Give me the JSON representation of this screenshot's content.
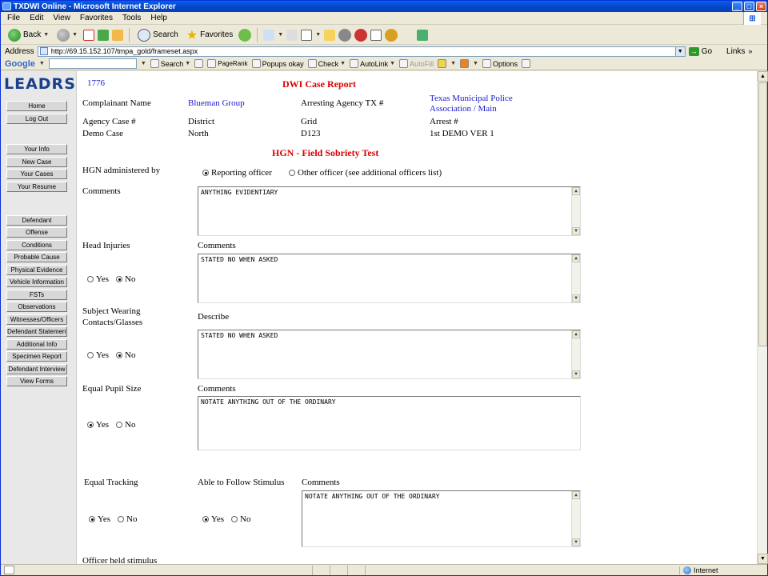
{
  "window": {
    "title": "TXDWI Online - Microsoft Internet Explorer"
  },
  "menu": [
    "File",
    "Edit",
    "View",
    "Favorites",
    "Tools",
    "Help"
  ],
  "toolbar": {
    "back": "Back",
    "search": "Search",
    "favorites": "Favorites"
  },
  "address": {
    "label": "Address",
    "url": "http://69.15.152.107/tmpa_gold/frameset.aspx",
    "go": "Go",
    "links": "Links"
  },
  "googlebar": {
    "logo": "Google",
    "search": "Search",
    "pagerank": "PageRank",
    "popups": "Popups okay",
    "check": "Check",
    "autolink": "AutoLink",
    "autofill": "AutoFill",
    "options": "Options"
  },
  "status": {
    "zone": "Internet"
  },
  "nav": {
    "logo": "LEADRS",
    "items": [
      "Home",
      "Log Out",
      "Your Info",
      "New Case",
      "Your Cases",
      "Your Resume",
      "Defendant",
      "Offense",
      "Conditions",
      "Probable Cause",
      "Physical Evidence",
      "Vehicle Information",
      "FSTs",
      "Observations",
      "Witnesses/Officers",
      "Defendant Statement",
      "Additional Info",
      "Specimen Report",
      "Defendant Interview",
      "View Forms"
    ]
  },
  "report": {
    "case_id": "1776",
    "title": "DWI Case Report",
    "complainant_label": "Complainant Name",
    "complainant_value": "Blueman Group",
    "arresting_agency_label": "Arresting Agency TX #",
    "arresting_agency_value_1": "Texas Municipal Police",
    "arresting_agency_value_2": "Association / Main",
    "agency_case_label": "Agency Case #",
    "district_label": "District",
    "grid_label": "Grid",
    "arrest_label": "Arrest #",
    "demo_case": "Demo Case",
    "north": "North",
    "grid_value": "D123",
    "arrest_value": "1st DEMO VER 1"
  },
  "hgn": {
    "section_title": "HGN - Field Sobriety Test",
    "administered_label": "HGN administered by",
    "reporting_officer": "Reporting officer",
    "other_officer": "Other officer (see additional officers list)",
    "comments_label": "Comments",
    "comments_text": "ANYTHING EVIDENTIARY",
    "head_injuries_label": "Head Injuries",
    "head_injuries_comments_label": "Comments",
    "head_injuries_text": "STATED NO WHEN ASKED",
    "yes": "Yes",
    "no": "No",
    "wearing_label_1": "Subject Wearing",
    "wearing_label_2": "Contacts/Glasses",
    "describe_label": "Describe",
    "wearing_text": "STATED NO WHEN ASKED",
    "pupil_label": "Equal Pupil Size",
    "pupil_comments_label": "Comments",
    "pupil_text": "NOTATE ANYTHING OUT OF THE ORDINARY",
    "tracking_label": "Equal Tracking",
    "follow_label": "Able to Follow Stimulus",
    "tracking_comments_label": "Comments",
    "tracking_text": "NOTATE ANYTHING OUT OF THE ORDINARY",
    "officer_held_label": "Officer held stimulus"
  }
}
